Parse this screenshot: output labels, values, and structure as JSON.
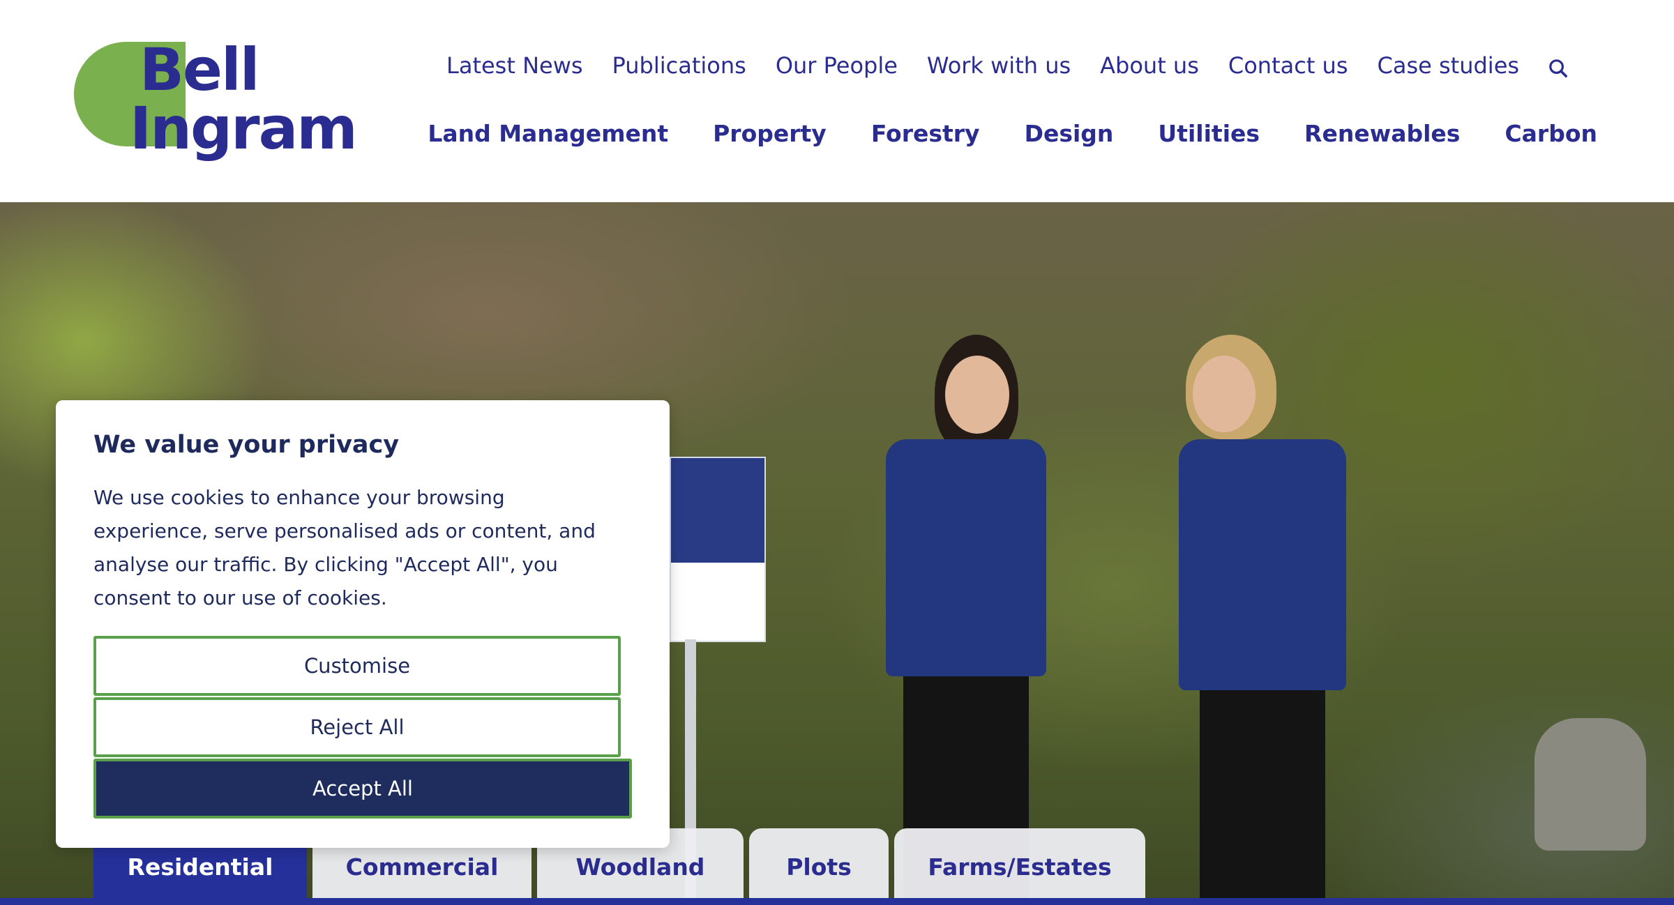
{
  "logo": {
    "line1": "Bell",
    "line2": "Ingram"
  },
  "top_nav": [
    "Latest News",
    "Publications",
    "Our People",
    "Work with us",
    "About us",
    "Contact us",
    "Case studies"
  ],
  "main_nav": [
    "Land Management",
    "Property",
    "Forestry",
    "Design",
    "Utilities",
    "Renewables",
    "Carbon"
  ],
  "cookie": {
    "title": "We value your privacy",
    "body": "We use cookies to enhance your browsing experience, serve personalised ads or content, and analyse our traffic. By clicking \"Accept All\", you consent to our use of cookies.",
    "customise": "Customise",
    "reject": "Reject All",
    "accept": "Accept All"
  },
  "tabs": [
    "Residential",
    "Commercial",
    "Woodland",
    "Plots",
    "Farms/Estates"
  ],
  "colors": {
    "brand_blue": "#2a2c8f",
    "brand_green": "#7ab04d",
    "accept_bg": "#1e2d5e",
    "tab_active": "#25309a"
  },
  "icons": {
    "search": "search-icon"
  }
}
